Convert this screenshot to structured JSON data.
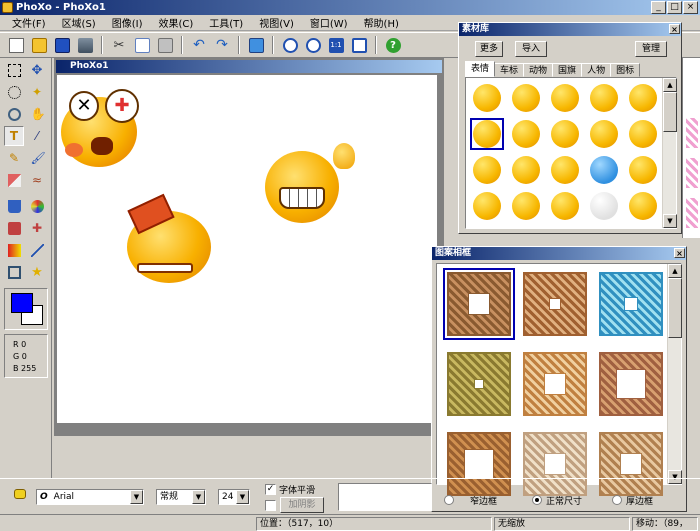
{
  "window": {
    "title": "PhoXo - PhoXo1"
  },
  "menu": [
    "文件(F)",
    "区域(S)",
    "图像(I)",
    "效果(C)",
    "工具(T)",
    "视图(V)",
    "窗口(W)",
    "帮助(H)"
  ],
  "toolbar_icons": [
    "new-icon",
    "open-icon",
    "save-icon",
    "scan-icon",
    "cut-icon",
    "copy-icon",
    "paste-icon",
    "undo-icon",
    "redo-icon",
    "screenshot-icon",
    "zoom-in-icon",
    "zoom-out-icon",
    "actual-size-icon",
    "fit-window-icon",
    "help-icon"
  ],
  "canvas": {
    "title": "PhoXo1"
  },
  "color": {
    "foreground": "#0000ff",
    "background": "#ffffff",
    "r": "R 0",
    "g": "G 0",
    "b": "B 255"
  },
  "material": {
    "title": "素材库",
    "more": "更多",
    "import": "导入",
    "manage": "管理",
    "tabs": [
      "表情",
      "车标",
      "动物",
      "国旗",
      "人物",
      "图标"
    ],
    "active_tab": "表情"
  },
  "frames": {
    "title": "图案相框",
    "options": [
      "窄边框",
      "正常尺寸",
      "厚边框"
    ],
    "selected_option": "正常尺寸"
  },
  "text_tool": {
    "font": "Arial",
    "style": "常规",
    "size": "24",
    "smooth_label": "字体平滑",
    "smooth_checked": "✓",
    "shadow_label": "加阴影"
  },
  "status": {
    "position": "位置：（517，10）",
    "zoom": "无缩放",
    "move": "移动：（89，"
  }
}
